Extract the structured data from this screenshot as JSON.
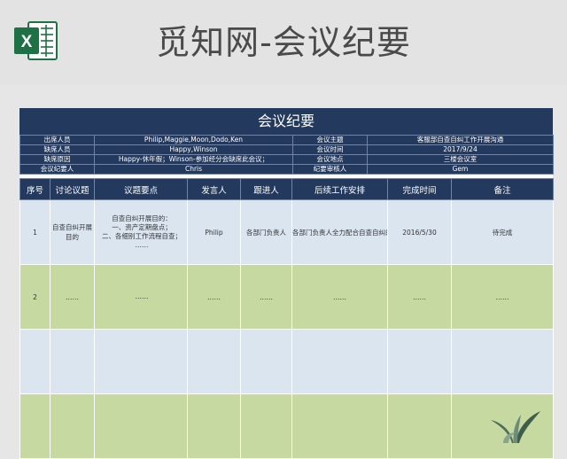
{
  "header": {
    "logo_letter": "X",
    "title": "觅知网-会议纪要"
  },
  "sheet": {
    "banner": "会议纪要",
    "info": [
      {
        "label": "出席人员",
        "value": "Philip,Maggie,Moon,Dodo,Ken",
        "label2": "会议主题",
        "value2": "客服部自查自纠工作开展沟通"
      },
      {
        "label": "缺席人员",
        "value": "Happy,Winson",
        "label2": "会议时间",
        "value2": "2017/9/24"
      },
      {
        "label": "缺席原因",
        "value": "Happy-休年假；Winson-参加经分会缺席此会议；",
        "label2": "会议地点",
        "value2": "三楼会议室"
      },
      {
        "label": "会议纪要人",
        "value": "Chris",
        "label2": "纪要审核人",
        "value2": "Gem"
      }
    ],
    "columns": [
      "序号",
      "讨论议题",
      "议题要点",
      "发言人",
      "跟进人",
      "后续工作安排",
      "完成时间",
      "备注"
    ],
    "rows": [
      {
        "no": "1",
        "topic": "自查自纠开展目的",
        "points": [
          "自查自纠开展目的：",
          "一、资产定期盘点；",
          "二、各细别工作流程自查；",
          "……"
        ],
        "speaker": "Philip",
        "follower": "各部门负责人",
        "plan": "各部门负责人全力配合自查自纠的开展工作",
        "done": "2016/5/30",
        "note": "待完成"
      },
      {
        "no": "2",
        "topic": "……",
        "points": [
          "……"
        ],
        "speaker": "……",
        "follower": "……",
        "plan": "……",
        "done": "……",
        "note": "……"
      },
      {
        "no": "",
        "topic": "",
        "points": [
          ""
        ],
        "speaker": "",
        "follower": "",
        "plan": "",
        "done": "",
        "note": ""
      },
      {
        "no": "",
        "topic": "",
        "points": [
          ""
        ],
        "speaker": "",
        "follower": "",
        "plan": "",
        "done": "",
        "note": ""
      }
    ]
  },
  "colors": {
    "navy": "#23395d",
    "row_blue": "#dbe5f0",
    "row_green": "#c5d9a0",
    "excel_green": "#1e7145"
  }
}
